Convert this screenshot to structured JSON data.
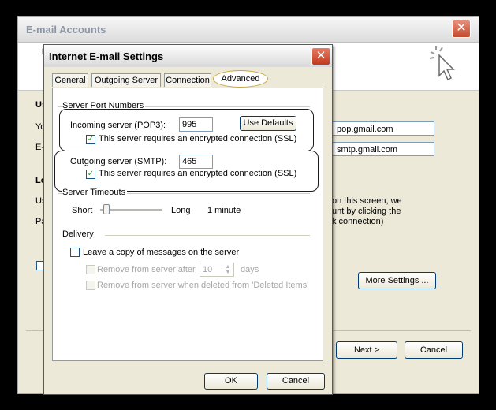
{
  "outer": {
    "title": "E-mail Accounts",
    "close_glyph": "✕",
    "frag_left_1": "I",
    "frag_left_us": "Us",
    "frag_left_yo": "Yo",
    "frag_left_e": "E-",
    "frag_left_lo": "Lo",
    "frag_left_us2": "Us",
    "frag_left_pa": "Pa",
    "incoming_value": "pop.gmail.com",
    "outgoing_value": "smtp.gmail.com",
    "text_line1": "on this screen, we",
    "text_line2": "unt by clicking the",
    "text_line3": "k connection)",
    "more_settings_label": "More Settings ...",
    "next_label": "Next >",
    "cancel_label": "Cancel"
  },
  "dialog": {
    "title": "Internet E-mail Settings",
    "close_glyph": "✕",
    "tabs": [
      "General",
      "Outgoing Server",
      "Connection",
      "Advanced"
    ],
    "server_ports": {
      "group_label": "Server Port Numbers",
      "incoming_label": "Incoming server (POP3):",
      "incoming_port": "995",
      "use_defaults_label": "Use Defaults",
      "incoming_ssl_label": "This server requires an encrypted connection (SSL)",
      "incoming_ssl_checked": true,
      "outgoing_label": "Outgoing server (SMTP):",
      "outgoing_port": "465",
      "outgoing_ssl_label": "This server requires an encrypted connection (SSL)",
      "outgoing_ssl_checked": true
    },
    "timeouts": {
      "group_label": "Server Timeouts",
      "short_label": "Short",
      "long_label": "Long",
      "value_label": "1 minute",
      "slider_level": 0.05
    },
    "delivery": {
      "group_label": "Delivery",
      "leave_copy_label": "Leave a copy of messages on the server",
      "leave_copy_checked": false,
      "remove_after_label": "Remove from server after",
      "remove_after_days": "10",
      "days_label": "days",
      "remove_deleted_label": "Remove from server when deleted from 'Deleted Items'"
    },
    "ok_label": "OK",
    "cancel_label": "Cancel"
  }
}
